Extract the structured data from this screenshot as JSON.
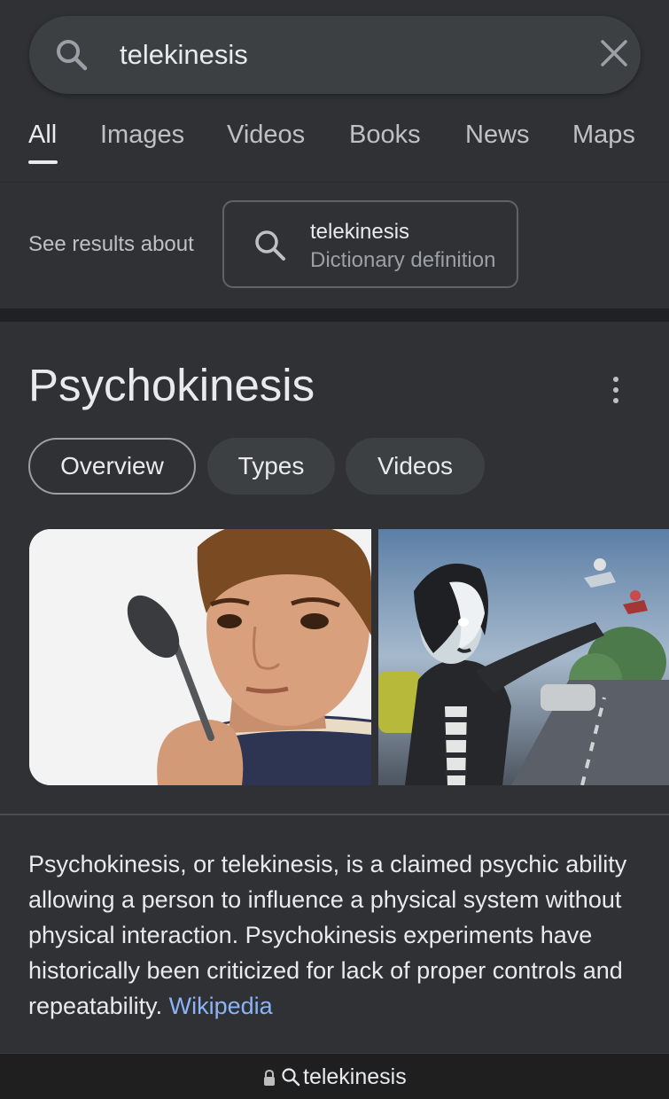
{
  "search": {
    "query": "telekinesis"
  },
  "tabs": [
    {
      "label": "All",
      "active": true
    },
    {
      "label": "Images"
    },
    {
      "label": "Videos"
    },
    {
      "label": "Books"
    },
    {
      "label": "News"
    },
    {
      "label": "Maps"
    }
  ],
  "see_results": {
    "label": "See results about",
    "chip_title": "telekinesis",
    "chip_subtitle": "Dictionary definition"
  },
  "knowledge_panel": {
    "title": "Psychokinesis",
    "pills": [
      {
        "label": "Overview",
        "active": true
      },
      {
        "label": "Types"
      },
      {
        "label": "Videos"
      }
    ],
    "description": "Psychokinesis, or telekinesis, is a claimed psychic ability allowing a person to influence a physical system without physical interaction. Psychokinesis experiments have historically been criticized for lack of proper controls and repeatability.",
    "source_link": "Wikipedia"
  },
  "address_bar": {
    "url_text": "telekinesis"
  },
  "colors": {
    "background": "#303134",
    "text": "#e8eaed",
    "muted": "#bdc1c6",
    "link": "#8ab4f8"
  }
}
